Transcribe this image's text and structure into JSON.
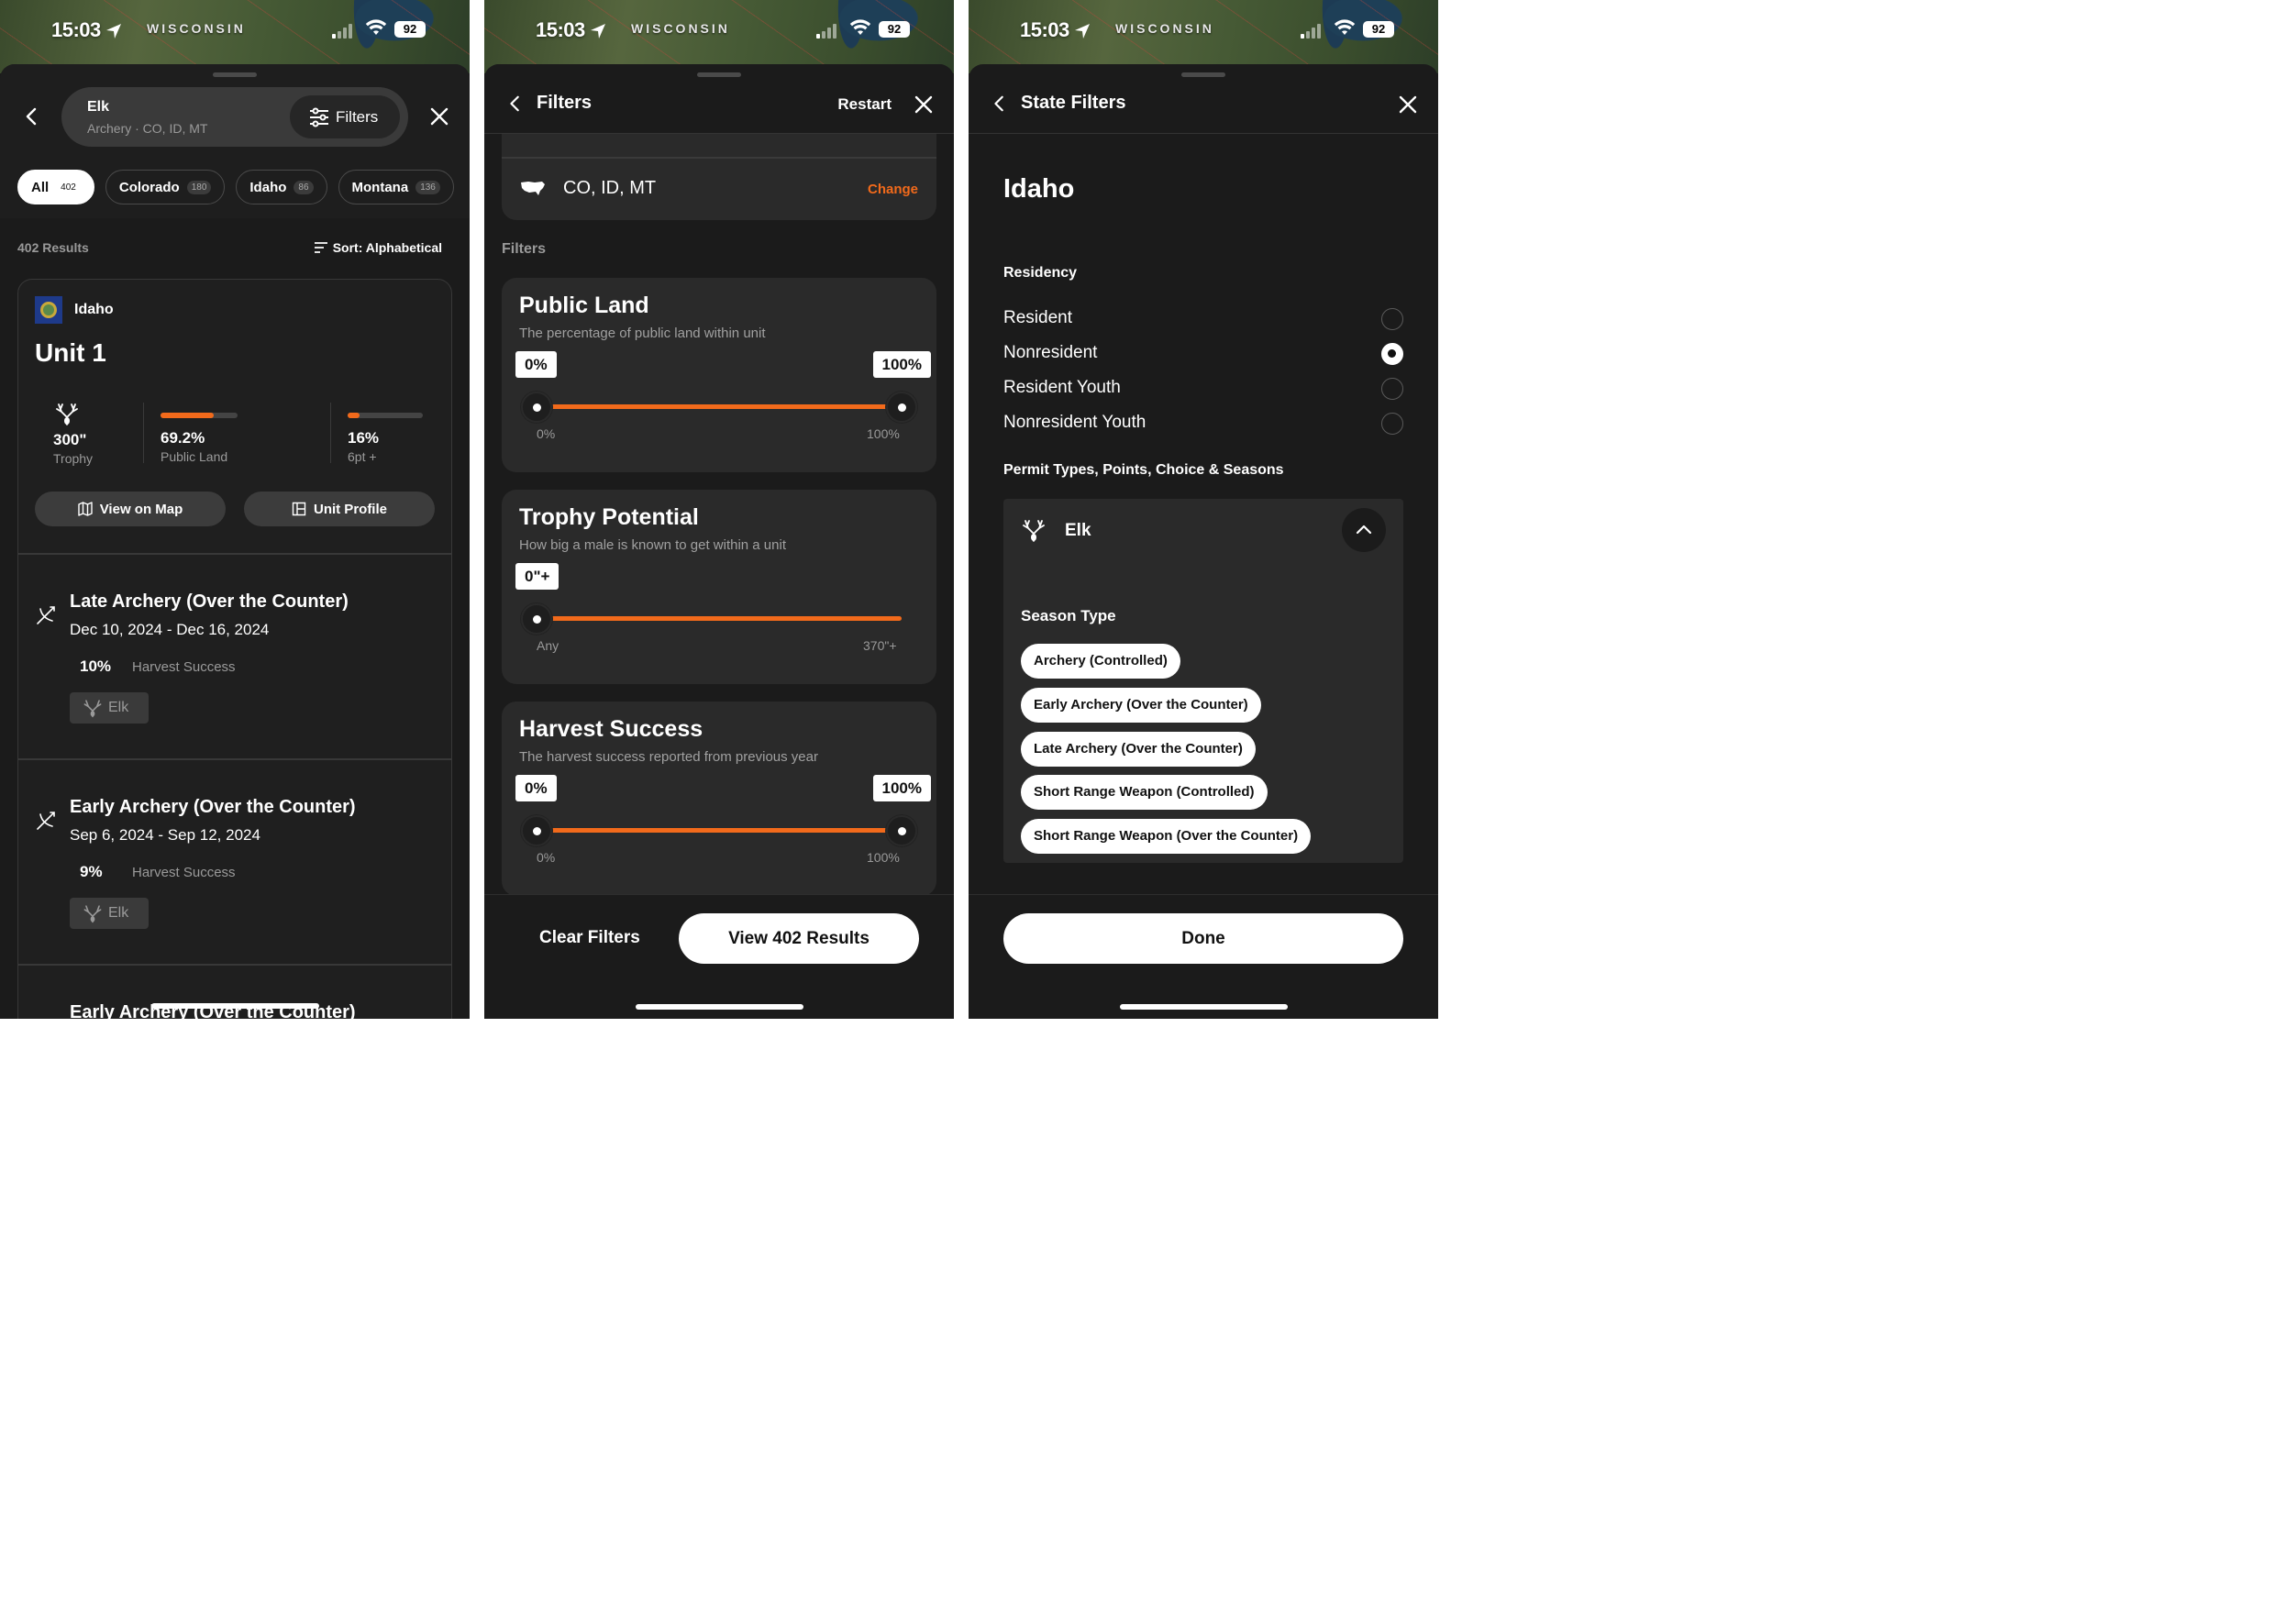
{
  "status": {
    "time": "15:03",
    "state_label": "WISCONSIN",
    "battery": "92"
  },
  "panel1": {
    "search_title": "Elk",
    "search_sub": "Archery · CO, ID, MT",
    "filters_label": "Filters",
    "chips": [
      {
        "label": "All",
        "count": "402"
      },
      {
        "label": "Colorado",
        "count": "180"
      },
      {
        "label": "Idaho",
        "count": "86"
      },
      {
        "label": "Montana",
        "count": "136"
      }
    ],
    "result_count": "402 Results",
    "sort_label": "Sort: Alphabetical",
    "card": {
      "state": "Idaho",
      "unit": "Unit 1",
      "stats": [
        {
          "value": "300\"",
          "label": "Trophy"
        },
        {
          "value": "69.2%",
          "label": "Public Land",
          "fill": 0.692
        },
        {
          "value": "16%",
          "label": "6pt +",
          "fill": 0.16
        }
      ],
      "view_map": "View on Map",
      "unit_profile": "Unit Profile",
      "seasons": [
        {
          "title": "Late Archery (Over the Counter)",
          "dates": "Dec 10, 2024 - Dec 16, 2024",
          "pct": "10%",
          "pct_label": "Harvest Success",
          "tag": "Elk"
        },
        {
          "title": "Early Archery (Over the Counter)",
          "dates": "Sep 6, 2024 - Sep 12, 2024",
          "pct": "9%",
          "pct_label": "Harvest Success",
          "tag": "Elk"
        },
        {
          "title": "Early Archery (Over the Counter)"
        }
      ]
    }
  },
  "panel2": {
    "title": "Filters",
    "restart": "Restart",
    "region_value": "CO, ID, MT",
    "region_change": "Change",
    "section_label": "Filters",
    "filters": [
      {
        "title": "Public Land",
        "desc": "The percentage of public land within unit",
        "min_box": "0%",
        "max_box": "100%",
        "min_tick": "0%",
        "max_tick": "100%"
      },
      {
        "title": "Trophy Potential",
        "desc": "How big a male is known to get within a unit",
        "min_box": "0\"+",
        "min_tick": "Any",
        "max_tick": "370\"+"
      },
      {
        "title": "Harvest Success",
        "desc": "The harvest success reported from previous year",
        "min_box": "0%",
        "max_box": "100%",
        "min_tick": "0%",
        "max_tick": "100%"
      }
    ],
    "clear_label": "Clear Filters",
    "view_label": "View 402 Results"
  },
  "panel3": {
    "title": "State Filters",
    "state": "Idaho",
    "residency_label": "Residency",
    "residency": [
      {
        "label": "Resident",
        "selected": false
      },
      {
        "label": "Nonresident",
        "selected": true
      },
      {
        "label": "Resident Youth",
        "selected": false
      },
      {
        "label": "Nonresident Youth",
        "selected": false
      }
    ],
    "permit_label": "Permit Types, Points, Choice & Seasons",
    "species": "Elk",
    "season_type_label": "Season Type",
    "season_types": [
      "Archery (Controlled)",
      "Early Archery (Over the Counter)",
      "Late Archery (Over the Counter)",
      "Short Range Weapon (Controlled)",
      "Short Range Weapon (Over the Counter)"
    ],
    "done_label": "Done"
  },
  "colors": {
    "accent": "#f26a1b",
    "sheet": "#1b1b1b",
    "card": "#2a2a2a"
  },
  "icons": [
    "back-icon",
    "close-icon",
    "filter-sliders-icon",
    "sort-icon",
    "map-icon",
    "layout-icon",
    "elk-antler-icon",
    "bow-arrow-icon",
    "usa-map-icon",
    "chevron-up-icon",
    "location-arrow-icon",
    "wifi-icon",
    "signal-icon"
  ]
}
